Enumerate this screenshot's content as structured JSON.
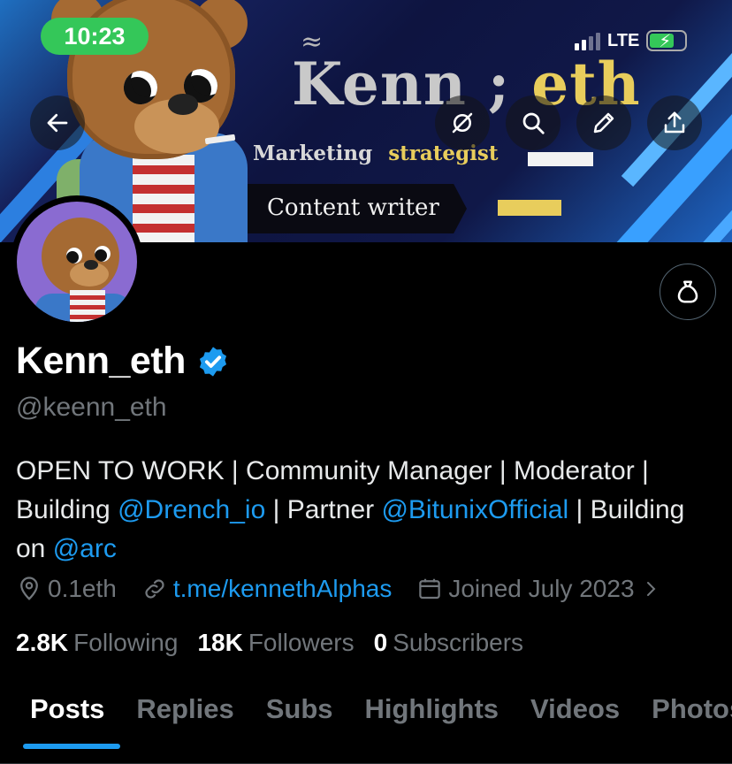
{
  "status_bar": {
    "time": "10:23",
    "network": "LTE"
  },
  "banner": {
    "title_left": "Kenn",
    "title_sep": " ;",
    "title_right": " eth",
    "tilde": "≈",
    "sub_left": "Marketing",
    "sub_right": "strategist",
    "content_label": "Content writer",
    "accent_gold": "#e8cd5c"
  },
  "header_buttons": {
    "back": "arrow-left-icon",
    "grok": "grok-icon",
    "search": "search-icon",
    "edit": "pencil-icon",
    "share": "share-icon"
  },
  "profile": {
    "display_name": "Kenn_eth",
    "handle": "@keenn_eth",
    "bio": {
      "part1": "OPEN TO WORK | Community Manager | Moderator | Building ",
      "mention1": "@Drench_io",
      "part2": " | Partner ",
      "mention2": "@BitunixOfficial",
      "part3": " | Building on ",
      "mention3": "@arc"
    },
    "location": "0.1eth",
    "link": "t.me/kennethAlphas",
    "joined": "Joined July 2023"
  },
  "stats": {
    "following_count": "2.8K",
    "following_label": "Following",
    "followers_count": "18K",
    "followers_label": "Followers",
    "subscribers_count": "0",
    "subscribers_label": "Subscribers"
  },
  "tabs": [
    "Posts",
    "Replies",
    "Subs",
    "Highlights",
    "Videos",
    "Photos"
  ],
  "colors": {
    "accent_blue": "#1d9bf0",
    "muted": "#71767b",
    "background": "#000000"
  }
}
